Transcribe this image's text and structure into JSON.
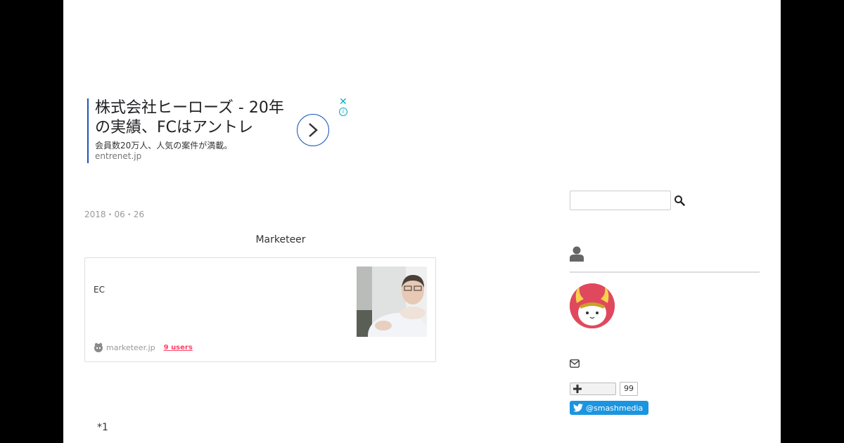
{
  "ad": {
    "title": "株式会社ヒーローズ - 20年の実績、FCはアントレ",
    "description": "会員数20万人、人気の案件が満載。",
    "url": "entrenet.jp",
    "close_icon": "close-icon",
    "info_icon": "info-icon"
  },
  "post": {
    "date": "2018・06・26",
    "card": {
      "title": "Marketeer",
      "text": "EC",
      "site": "marketeer.jp",
      "users": "9 users"
    },
    "footnote": "*1"
  },
  "sidebar": {
    "search": {
      "placeholder": "",
      "icon": "search-icon"
    },
    "profile_icon": "user-icon",
    "mail_icon": "envelope-icon",
    "follow": {
      "icon": "plus-icon",
      "count": "99"
    },
    "twitter": {
      "label": "@smashmedia",
      "icon": "twitter-bird-icon",
      "color": "#1b95e0"
    }
  },
  "colors": {
    "ad_accent": "#1a57b7",
    "users_link": "#ff4166",
    "close_icon": "#00aecd"
  }
}
